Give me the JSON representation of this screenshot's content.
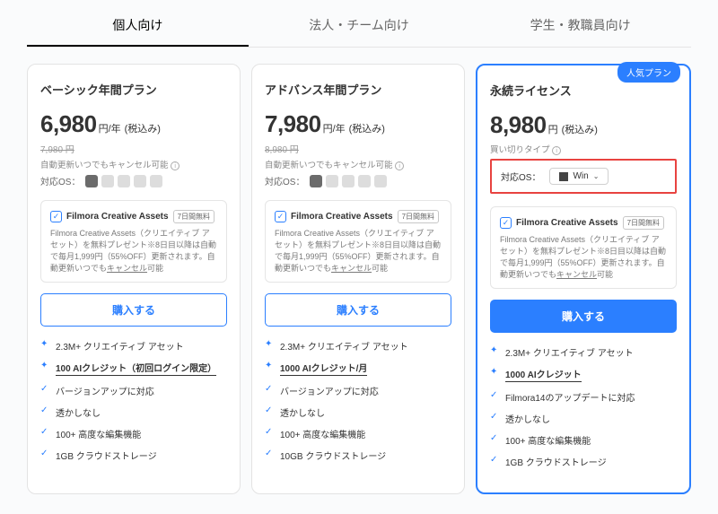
{
  "tabs": [
    {
      "label": "個人向け",
      "active": true
    },
    {
      "label": "法人・チーム向け",
      "active": false
    },
    {
      "label": "学生・教職員向け",
      "active": false
    }
  ],
  "popular_badge": "人気プラン",
  "os_label": "対応OS：",
  "os_select": "Win",
  "assets": {
    "name": "Filmora Creative Assets",
    "tag": "7日間無料",
    "desc_a": "Filmora Creative Assets（クリエイティブ アセット）を無料プレゼント※8日目以降は自動で毎月1,999円（55%OFF）更新されます。自動更新いつでも",
    "desc_cancel": "キャンセル",
    "desc_b": "可能"
  },
  "buy": "購入する",
  "plans": [
    {
      "title": "ベーシック年間プラン",
      "price": "6,980",
      "unit": "円/年",
      "tax": "(税込み)",
      "strike": "7,980 円",
      "renew": "自動更新いつでもキャンセル可能",
      "features": [
        {
          "mk": "spark",
          "txt": "2.3M+ クリエイティブ アセット",
          "bold": false
        },
        {
          "mk": "spark",
          "txt": "100 AIクレジット（初回ログイン限定）",
          "bold": true
        },
        {
          "mk": "check",
          "txt": "バージョンアップに対応",
          "bold": false
        },
        {
          "mk": "check",
          "txt": "透かしなし",
          "bold": false
        },
        {
          "mk": "check",
          "txt": "100+ 高度な編集機能",
          "bold": false
        },
        {
          "mk": "check",
          "txt": "1GB クラウドストレージ",
          "bold": false
        }
      ]
    },
    {
      "title": "アドバンス年間プラン",
      "price": "7,980",
      "unit": "円/年",
      "tax": "(税込み)",
      "strike": "8,980 円",
      "renew": "自動更新いつでもキャンセル可能",
      "features": [
        {
          "mk": "spark",
          "txt": "2.3M+ クリエイティブ アセット",
          "bold": false
        },
        {
          "mk": "spark",
          "txt": "1000 AIクレジット/月",
          "bold": true
        },
        {
          "mk": "check",
          "txt": "バージョンアップに対応",
          "bold": false
        },
        {
          "mk": "check",
          "txt": "透かしなし",
          "bold": false
        },
        {
          "mk": "check",
          "txt": "100+ 高度な編集機能",
          "bold": false
        },
        {
          "mk": "check",
          "txt": "10GB クラウドストレージ",
          "bold": false
        }
      ]
    },
    {
      "title": "永続ライセンス",
      "price": "8,980",
      "unit": "円",
      "tax": "(税込み)",
      "strike": "",
      "renew": "買い切りタイプ",
      "os_select": true,
      "highlight": true,
      "features": [
        {
          "mk": "spark",
          "txt": "2.3M+ クリエイティブ アセット",
          "bold": false
        },
        {
          "mk": "spark",
          "txt": "1000 AIクレジット",
          "bold": true
        },
        {
          "mk": "check",
          "txt": "Filmora14のアップデートに対応",
          "bold": false
        },
        {
          "mk": "check",
          "txt": "透かしなし",
          "bold": false
        },
        {
          "mk": "check",
          "txt": "100+ 高度な編集機能",
          "bold": false
        },
        {
          "mk": "check",
          "txt": "1GB クラウドストレージ",
          "bold": false
        }
      ]
    }
  ]
}
